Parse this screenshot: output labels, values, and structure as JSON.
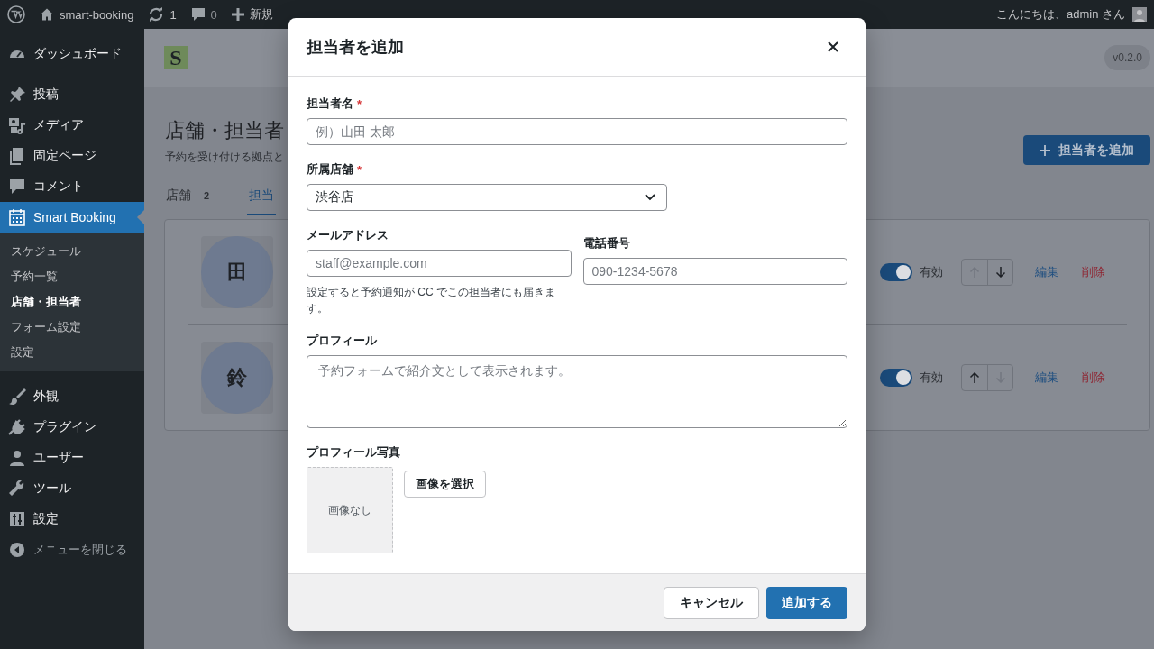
{
  "admin_bar": {
    "site": "smart-booking",
    "updates": "1",
    "comments": "0",
    "new": "新規",
    "greeting": "こんにちは、admin さん"
  },
  "sidebar": {
    "items": [
      {
        "label": "ダッシュボード",
        "selected": false
      },
      {
        "label": "投稿",
        "selected": false
      },
      {
        "label": "メディア",
        "selected": false
      },
      {
        "label": "固定ページ",
        "selected": false
      },
      {
        "label": "コメント",
        "selected": false
      },
      {
        "label": "Smart Booking",
        "selected": true,
        "children": [
          {
            "label": "スケジュール",
            "selected": false
          },
          {
            "label": "予約一覧",
            "selected": false
          },
          {
            "label": "店舗・担当者",
            "selected": true
          },
          {
            "label": "フォーム設定",
            "selected": false
          },
          {
            "label": "設定",
            "selected": false
          }
        ]
      },
      {
        "label": "外観",
        "selected": false
      },
      {
        "label": "プラグイン",
        "selected": false
      },
      {
        "label": "ユーザー",
        "selected": false
      },
      {
        "label": "ツール",
        "selected": false
      },
      {
        "label": "設定",
        "selected": false
      }
    ],
    "collapse": "メニューを閉じる"
  },
  "page": {
    "logo": "S",
    "version": "v0.2.0",
    "title": "店舗・担当者",
    "subtitle": "予約を受け付ける拠点と",
    "add_button": "担当者を追加",
    "tabs": [
      {
        "label": "店舗",
        "count": "2",
        "selected": false
      },
      {
        "label": "担当",
        "selected": true
      }
    ],
    "staff": [
      {
        "avatar": "田",
        "active": true,
        "status": "有効",
        "up_disabled": true,
        "down_disabled": false,
        "edit": "編集",
        "delete": "削除"
      },
      {
        "avatar": "鈴",
        "active": true,
        "status": "有効",
        "up_disabled": false,
        "down_disabled": true,
        "edit": "編集",
        "delete": "削除"
      }
    ]
  },
  "modal": {
    "title": "担当者を追加",
    "fields": [
      {
        "kind": "text",
        "label": "担当者名",
        "required_mark": "*",
        "placeholder": "例）山田 太郎"
      },
      {
        "kind": "select",
        "label": "所属店舗",
        "required_mark": "*",
        "value": "渋谷店"
      },
      {
        "kind": "pair",
        "items": [
          {
            "label": "メールアドレス",
            "placeholder": "staff@example.com",
            "help": "設定すると予約通知が CC でこの担当者にも届きます。"
          },
          {
            "label": "電話番号",
            "placeholder": "090-1234-5678"
          }
        ]
      },
      {
        "kind": "textarea",
        "label": "プロフィール",
        "placeholder": "予約フォームで紹介文として表示されます。"
      },
      {
        "kind": "image",
        "label": "プロフィール写真",
        "empty": "画像なし",
        "button": "画像を選択"
      }
    ],
    "cancel": "キャンセル",
    "submit": "追加する"
  }
}
